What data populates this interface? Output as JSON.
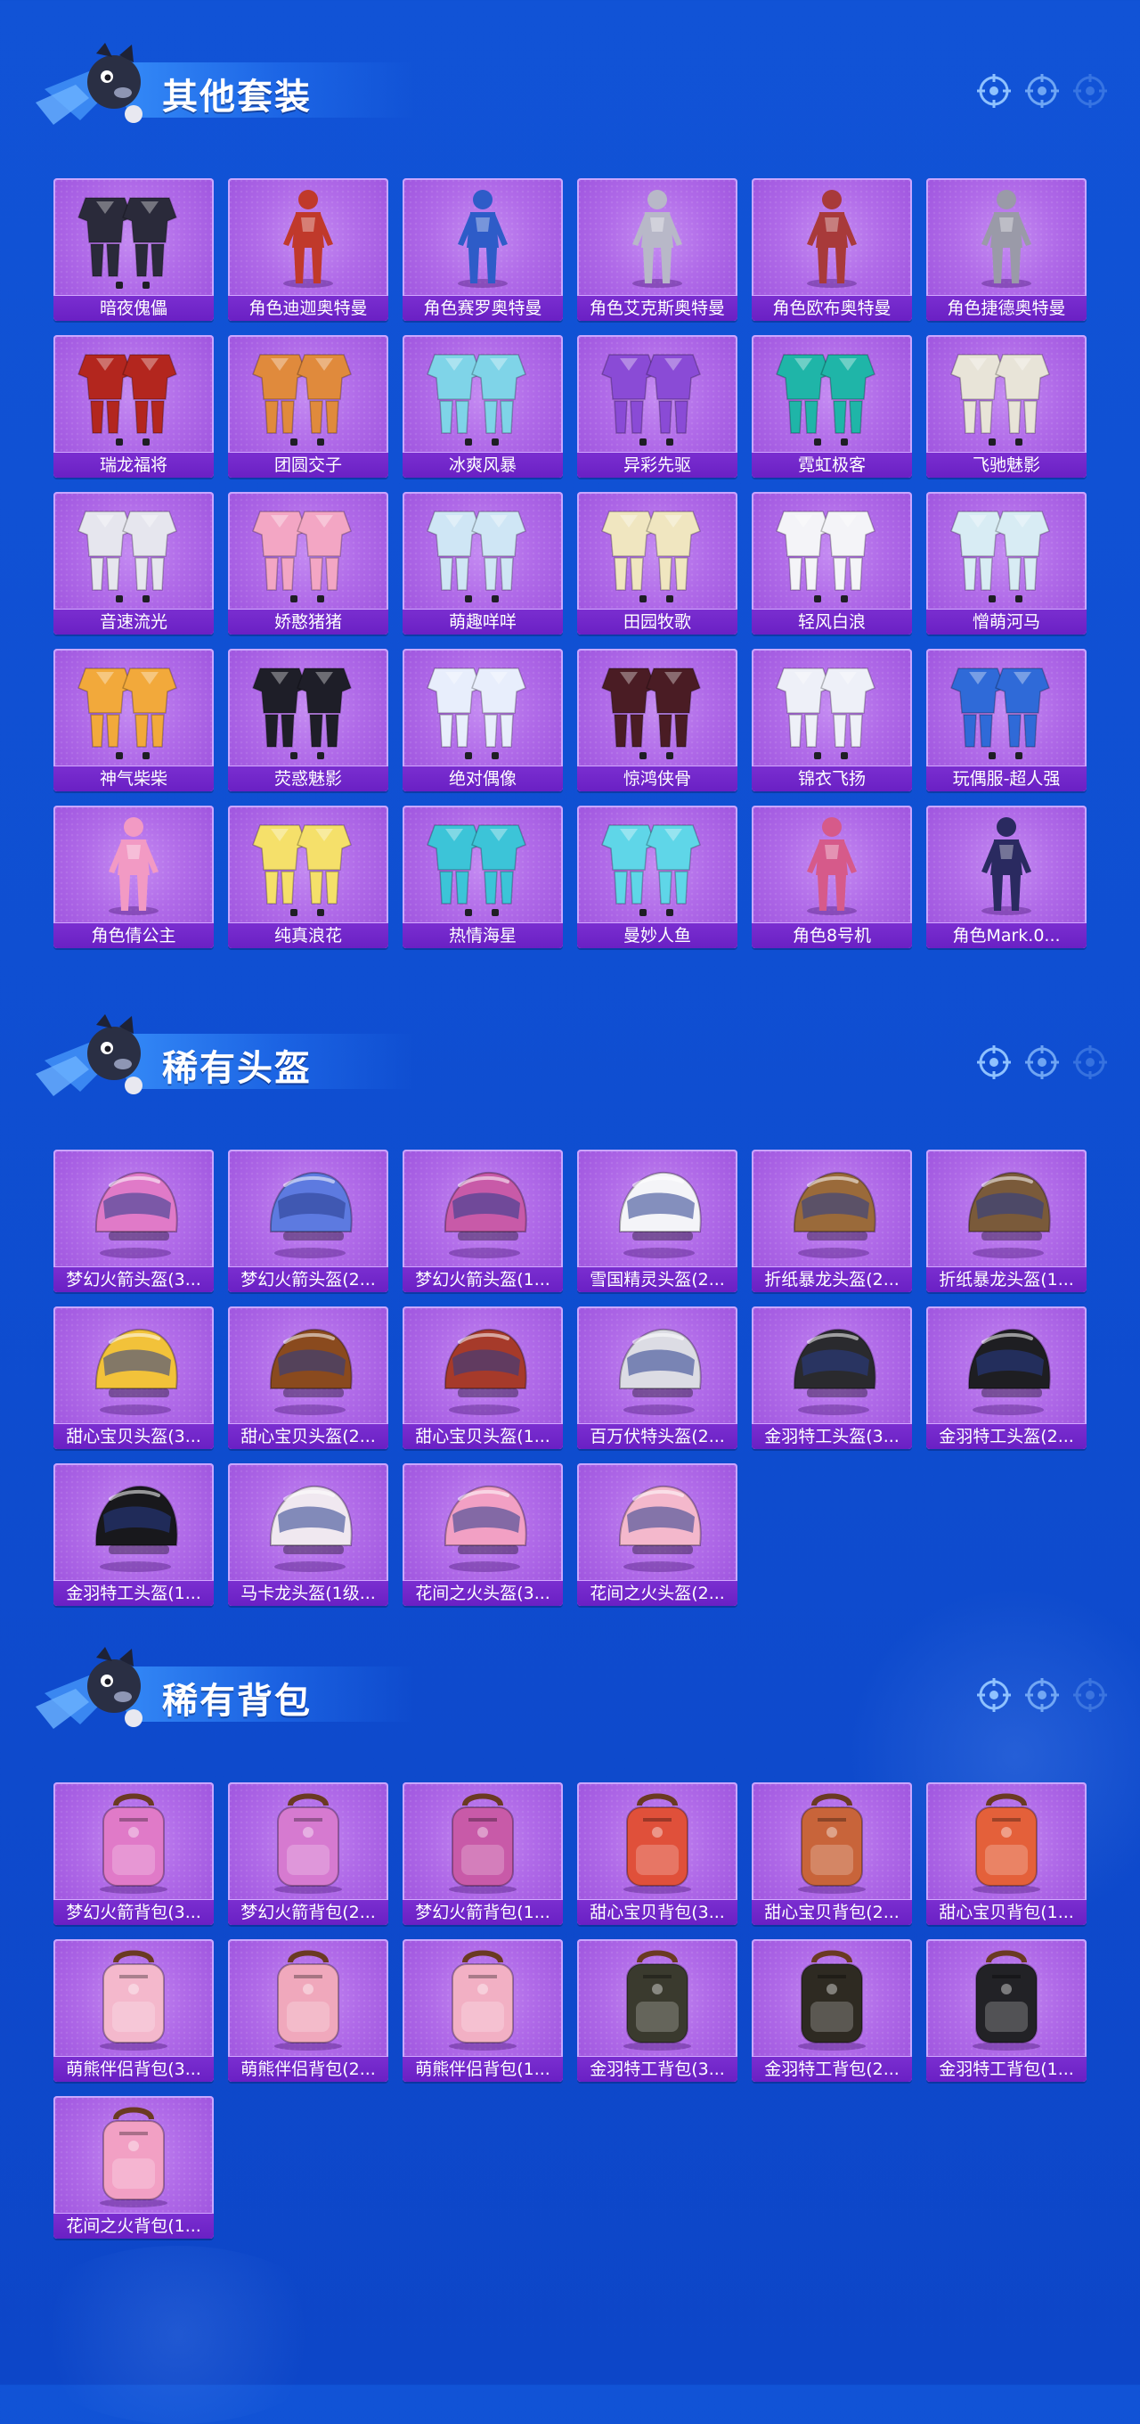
{
  "sections": [
    {
      "title": "其他套装",
      "kind": "outfit",
      "items": [
        {
          "label": "暗夜傀儡",
          "icon": "outfit-icon",
          "color": "#2a2a3a"
        },
        {
          "label": "角色迪迦奥特曼",
          "icon": "hero-figure-icon",
          "color": "#c0392b"
        },
        {
          "label": "角色赛罗奥特曼",
          "icon": "hero-figure-icon",
          "color": "#2e5cc8"
        },
        {
          "label": "角色艾克斯奥特曼",
          "icon": "hero-figure-icon",
          "color": "#b8b8c8"
        },
        {
          "label": "角色欧布奥特曼",
          "icon": "hero-figure-icon",
          "color": "#a83a3a"
        },
        {
          "label": "角色捷德奥特曼",
          "icon": "hero-figure-icon",
          "color": "#9a9aa8"
        },
        {
          "label": "瑞龙福将",
          "icon": "outfit-icon",
          "color": "#b3261e"
        },
        {
          "label": "团圆交子",
          "icon": "outfit-icon",
          "color": "#e08a3c"
        },
        {
          "label": "冰爽风暴",
          "icon": "outfit-icon",
          "color": "#7fd4e8"
        },
        {
          "label": "异彩先驱",
          "icon": "outfit-icon",
          "color": "#8a4bd6"
        },
        {
          "label": "霓虹极客",
          "icon": "outfit-icon",
          "color": "#1fb5a8"
        },
        {
          "label": "飞驰魅影",
          "icon": "outfit-icon",
          "color": "#e8e4d8"
        },
        {
          "label": "音速流光",
          "icon": "outfit-icon",
          "color": "#e6e6ee"
        },
        {
          "label": "娇憨猪猪",
          "icon": "outfit-icon",
          "color": "#f3a6c4"
        },
        {
          "label": "萌趣咩咩",
          "icon": "outfit-icon",
          "color": "#cfe6f5"
        },
        {
          "label": "田园牧歌",
          "icon": "outfit-icon",
          "color": "#f0e6c0"
        },
        {
          "label": "轻风白浪",
          "icon": "outfit-icon",
          "color": "#f4f4f8"
        },
        {
          "label": "憎萌河马",
          "icon": "outfit-icon",
          "color": "#d8ecf4"
        },
        {
          "label": "神气柴柴",
          "icon": "outfit-icon",
          "color": "#f2a93b"
        },
        {
          "label": "荧惑魅影",
          "icon": "outfit-icon",
          "color": "#1e1e28"
        },
        {
          "label": "绝对偶像",
          "icon": "outfit-icon",
          "color": "#e8eefc"
        },
        {
          "label": "惊鸿侠骨",
          "icon": "outfit-icon",
          "color": "#4a1c24"
        },
        {
          "label": "锦衣飞扬",
          "icon": "outfit-icon",
          "color": "#eef0f8"
        },
        {
          "label": "玩偶服-超人强",
          "icon": "outfit-icon",
          "color": "#2f6ad8"
        },
        {
          "label": "角色倩公主",
          "icon": "hero-figure-icon",
          "color": "#f29ac4"
        },
        {
          "label": "纯真浪花",
          "icon": "outfit-icon",
          "color": "#f5e06a"
        },
        {
          "label": "热情海星",
          "icon": "outfit-icon",
          "color": "#3cc4d8"
        },
        {
          "label": "曼妙人鱼",
          "icon": "outfit-icon",
          "color": "#5fd6e8"
        },
        {
          "label": "角色8号机",
          "icon": "hero-figure-icon",
          "color": "#d65a8a"
        },
        {
          "label": "角色Mark.0...",
          "icon": "hero-figure-icon",
          "color": "#2a2a60"
        }
      ]
    },
    {
      "title": "稀有头盔",
      "kind": "helmet",
      "items": [
        {
          "label": "梦幻火箭头盔(3...",
          "icon": "helmet-icon",
          "color": "#e07ac8"
        },
        {
          "label": "梦幻火箭头盔(2...",
          "icon": "helmet-icon",
          "color": "#5d7ae0"
        },
        {
          "label": "梦幻火箭头盔(1...",
          "icon": "helmet-icon",
          "color": "#c85aa8"
        },
        {
          "label": "雪国精灵头盔(2...",
          "icon": "helmet-icon",
          "color": "#f4f4f8"
        },
        {
          "label": "折纸暴龙头盔(2...",
          "icon": "helmet-icon",
          "color": "#9a6a3a"
        },
        {
          "label": "折纸暴龙头盔(1...",
          "icon": "helmet-icon",
          "color": "#7a5a3a"
        },
        {
          "label": "甜心宝贝头盔(3...",
          "icon": "helmet-icon",
          "color": "#f2c23a"
        },
        {
          "label": "甜心宝贝头盔(2...",
          "icon": "helmet-icon",
          "color": "#8a4a1e"
        },
        {
          "label": "甜心宝贝头盔(1...",
          "icon": "helmet-icon",
          "color": "#a63a2a"
        },
        {
          "label": "百万伏特头盔(2...",
          "icon": "helmet-icon",
          "color": "#dcdce4"
        },
        {
          "label": "金羽特工头盔(3...",
          "icon": "helmet-icon",
          "color": "#2a2a2e"
        },
        {
          "label": "金羽特工头盔(2...",
          "icon": "helmet-icon",
          "color": "#1e1e22"
        },
        {
          "label": "金羽特工头盔(1...",
          "icon": "helmet-icon",
          "color": "#18181c"
        },
        {
          "label": "马卡龙头盔(1级...",
          "icon": "helmet-icon",
          "color": "#f0e8f0"
        },
        {
          "label": "花间之火头盔(3...",
          "icon": "helmet-icon",
          "color": "#f2a0c4"
        },
        {
          "label": "花间之火头盔(2...",
          "icon": "helmet-icon",
          "color": "#f4b8cc"
        }
      ]
    },
    {
      "title": "稀有背包",
      "kind": "backpack",
      "items": [
        {
          "label": "梦幻火箭背包(3...",
          "icon": "backpack-icon",
          "color": "#e07ac8"
        },
        {
          "label": "梦幻火箭背包(2...",
          "icon": "backpack-icon",
          "color": "#d67ad0"
        },
        {
          "label": "梦幻火箭背包(1...",
          "icon": "backpack-icon",
          "color": "#c85aa8"
        },
        {
          "label": "甜心宝贝背包(3...",
          "icon": "backpack-icon",
          "color": "#e0503a"
        },
        {
          "label": "甜心宝贝背包(2...",
          "icon": "backpack-icon",
          "color": "#c8643a"
        },
        {
          "label": "甜心宝贝背包(1...",
          "icon": "backpack-icon",
          "color": "#e4603a"
        },
        {
          "label": "萌熊伴侣背包(3...",
          "icon": "backpack-icon",
          "color": "#f4b8cc"
        },
        {
          "label": "萌熊伴侣背包(2...",
          "icon": "backpack-icon",
          "color": "#f0a8bc"
        },
        {
          "label": "萌熊伴侣背包(1...",
          "icon": "backpack-icon",
          "color": "#f2b0c4"
        },
        {
          "label": "金羽特工背包(3...",
          "icon": "backpack-icon",
          "color": "#3a3a2e"
        },
        {
          "label": "金羽特工背包(2...",
          "icon": "backpack-icon",
          "color": "#2e2a22"
        },
        {
          "label": "金羽特工背包(1...",
          "icon": "backpack-icon",
          "color": "#222226"
        },
        {
          "label": "花间之火背包(1...",
          "icon": "backpack-icon",
          "color": "#f2a0c4"
        }
      ]
    }
  ]
}
